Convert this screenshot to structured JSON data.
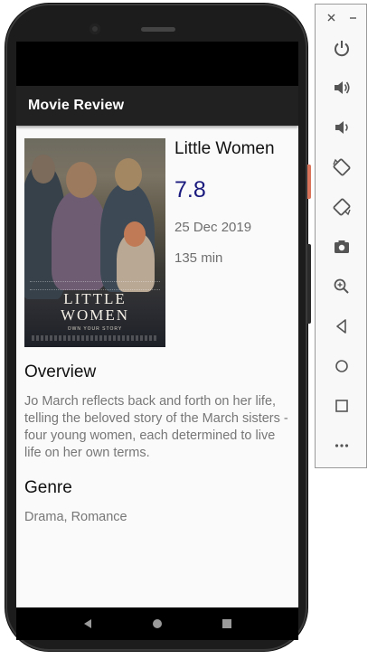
{
  "app": {
    "title": "Movie Review"
  },
  "movie": {
    "title": "Little Women",
    "rating": "7.8",
    "release_date": "25 Dec 2019",
    "runtime": "135 min",
    "poster": {
      "title_line1": "LITTLE",
      "title_line2": "WOMEN",
      "tagline": "OWN YOUR STORY"
    }
  },
  "sections": {
    "overview_heading": "Overview",
    "overview_text": "Jo March reflects back and forth on her life, telling the beloved story of the March sisters - four young women, each determined to live life on her own terms.",
    "genre_heading": "Genre",
    "genre_text": "Drama, Romance"
  },
  "nav": {
    "icons": [
      "back-icon",
      "home-icon",
      "recents-icon"
    ]
  },
  "emulator_toolbar": {
    "window_controls": [
      "close-icon",
      "minimize-icon"
    ],
    "buttons": [
      "power-icon",
      "volume-up-icon",
      "volume-down-icon",
      "rotate-left-icon",
      "rotate-right-icon",
      "camera-icon",
      "zoom-icon",
      "back-icon",
      "home-icon",
      "overview-icon",
      "more-icon"
    ]
  },
  "colors": {
    "app_bar": "#212121",
    "rating": "#1a1a7e",
    "secondary_text": "#6f6f6f",
    "background": "#fafafa",
    "toolbar_icon": "#555555"
  }
}
